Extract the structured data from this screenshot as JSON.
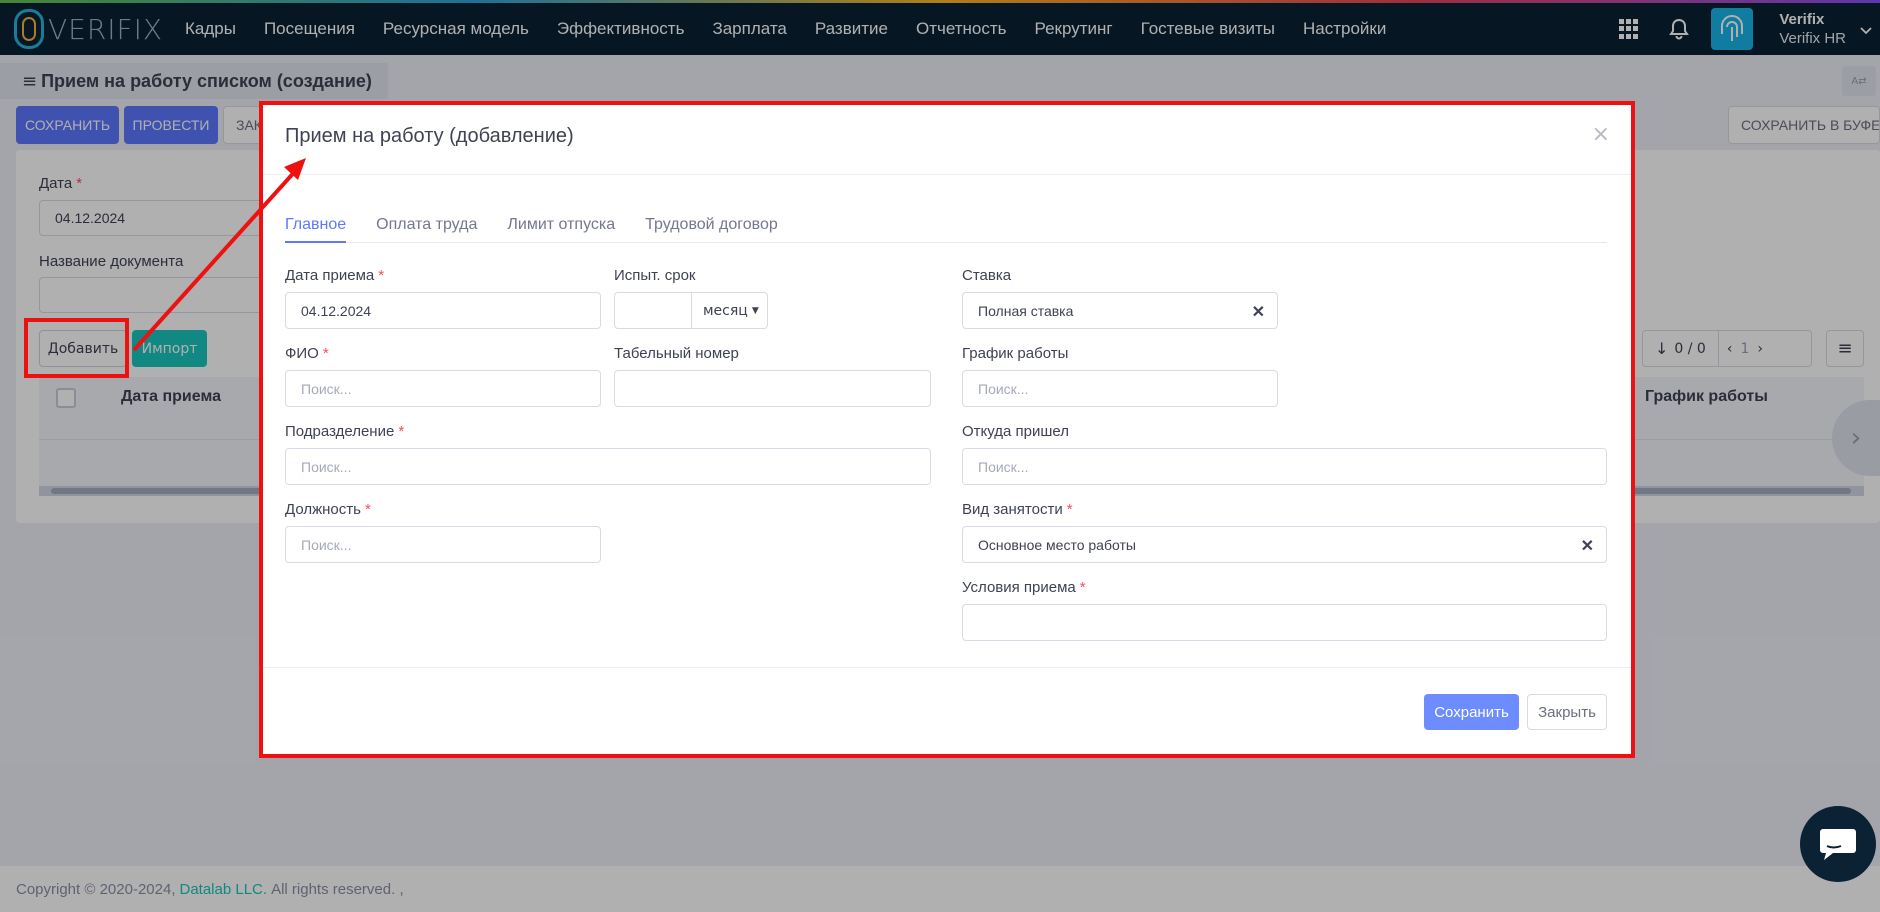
{
  "app": {
    "logo_text": "VERIFIX",
    "nav": [
      "Кадры",
      "Посещения",
      "Ресурсная модель",
      "Эффективность",
      "Зарплата",
      "Развитие",
      "Отчетность",
      "Рекрутинг",
      "Гостевые визиты",
      "Настройки"
    ],
    "user": {
      "name": "Verifix",
      "org": "Verifix HR"
    },
    "icons": {
      "apps": "apps-grid-icon",
      "notifications": "bell-icon",
      "avatar": "fingerprint-icon"
    }
  },
  "page": {
    "title": "Прием на работу списком (создание)",
    "buttons": {
      "save": "СОХРАНИТЬ",
      "post": "ПРОВЕСТИ",
      "close_partial": "ЗАК",
      "save_buffer": "СОХРАНИТЬ В БУФЕР"
    },
    "lang_toggle": "A⇄",
    "form": {
      "date_label": "Дата",
      "date_value": "04.12.2024",
      "doc_name_label": "Название документа",
      "doc_name_value": ""
    },
    "list": {
      "add_label": "Добавить",
      "import_label": "Импорт",
      "pager_count": "0 / 0",
      "pager_page": "1",
      "columns": [
        "Дата приема",
        "График работы"
      ]
    }
  },
  "footer": {
    "copyright": "Copyright © 2020-2024,",
    "company": "Datalab LLC.",
    "rights": "All rights reserved. ,"
  },
  "modal": {
    "title": "Прием на работу (добавление)",
    "close_glyph": "×",
    "tabs": [
      {
        "label": "Главное",
        "active": true
      },
      {
        "label": "Оплата труда",
        "active": false
      },
      {
        "label": "Лимит отпуска",
        "active": false
      },
      {
        "label": "Трудовой договор",
        "active": false
      }
    ],
    "fields": {
      "hire_date": {
        "label": "Дата приема",
        "value": "04.12.2024",
        "required": true
      },
      "probation": {
        "label": "Испыт. срок",
        "value": "",
        "unit": "месяц"
      },
      "rate": {
        "label": "Ставка",
        "value": "Полная ставка"
      },
      "fio": {
        "label": "ФИО",
        "placeholder": "Поиск...",
        "required": true
      },
      "tab_number": {
        "label": "Табельный номер",
        "value": ""
      },
      "schedule": {
        "label": "График работы",
        "placeholder": "Поиск..."
      },
      "division": {
        "label": "Подразделение",
        "placeholder": "Поиск...",
        "required": true
      },
      "came_from": {
        "label": "Откуда пришел",
        "placeholder": "Поиск..."
      },
      "position": {
        "label": "Должность",
        "placeholder": "Поиск...",
        "required": true
      },
      "employment_type": {
        "label": "Вид занятости",
        "value": "Основное место работы",
        "required": true
      },
      "hire_conditions": {
        "label": "Условия приема",
        "value": "",
        "required": true
      }
    },
    "buttons": {
      "save": "Сохранить",
      "close": "Закрыть"
    }
  },
  "colors": {
    "primary": "#5d78ff",
    "accent_teal": "#1bc5bd",
    "highlight_red": "#ee1111",
    "navbar": "#0a2233"
  }
}
